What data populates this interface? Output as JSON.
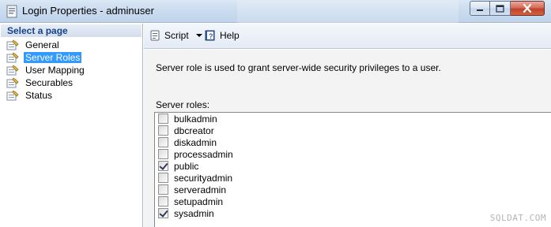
{
  "window": {
    "title": "Login Properties - adminuser",
    "controls": {
      "minimize": "minimize-icon",
      "maximize": "maximize-icon",
      "close": "close-icon"
    }
  },
  "sidebar": {
    "header": "Select a page",
    "items": [
      {
        "label": "General",
        "icon": "page-wrench-icon",
        "selected": false
      },
      {
        "label": "Server Roles",
        "icon": "page-wrench-icon",
        "selected": true
      },
      {
        "label": "User Mapping",
        "icon": "page-wrench-icon",
        "selected": false
      },
      {
        "label": "Securables",
        "icon": "page-wrench-icon",
        "selected": false
      },
      {
        "label": "Status",
        "icon": "page-wrench-icon",
        "selected": false
      }
    ]
  },
  "toolbar": {
    "script_label": "Script",
    "help_label": "Help"
  },
  "main": {
    "description": "Server role is used to grant server-wide security privileges to a user.",
    "roles_label": "Server roles:",
    "roles": [
      {
        "name": "bulkadmin",
        "checked": false
      },
      {
        "name": "dbcreator",
        "checked": false
      },
      {
        "name": "diskadmin",
        "checked": false
      },
      {
        "name": "processadmin",
        "checked": false
      },
      {
        "name": "public",
        "checked": true
      },
      {
        "name": "securityadmin",
        "checked": false
      },
      {
        "name": "serveradmin",
        "checked": false
      },
      {
        "name": "setupadmin",
        "checked": false
      },
      {
        "name": "sysadmin",
        "checked": true
      }
    ]
  },
  "watermark": "SQLDAT.COM",
  "colors": {
    "selection": "#3399ff",
    "header_text": "#15428b",
    "close_button": "#c0412c"
  }
}
